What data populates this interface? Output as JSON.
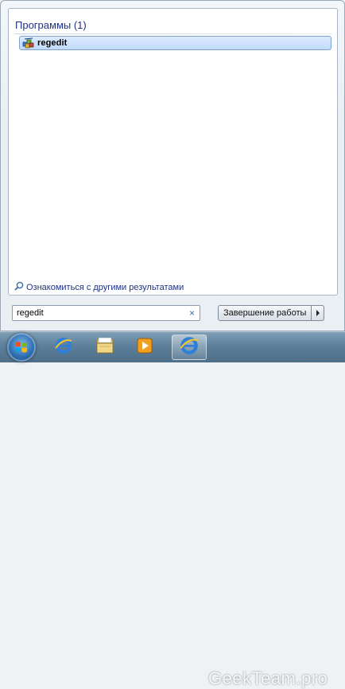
{
  "start_menu": {
    "group_header": "Программы (1)",
    "results": [
      {
        "label": "regedit",
        "icon": "regedit-icon"
      }
    ],
    "more_results_label": "Ознакомиться с другими результатами",
    "search": {
      "value": "regedit",
      "clear_symbol": "×"
    },
    "shutdown_label": "Завершение работы",
    "shutdown_arrow": "▸"
  },
  "taskbar": {
    "buttons": [
      {
        "icon": "internet-explorer-icon"
      },
      {
        "icon": "file-explorer-icon"
      },
      {
        "icon": "media-player-icon"
      },
      {
        "icon": "internet-explorer-icon",
        "active": true
      }
    ],
    "watermark": "GeekTeam.pro"
  },
  "colors": {
    "header_text": "#1e3287",
    "selection": "#c1dbfc",
    "taskbar": "#5d7f9a"
  }
}
